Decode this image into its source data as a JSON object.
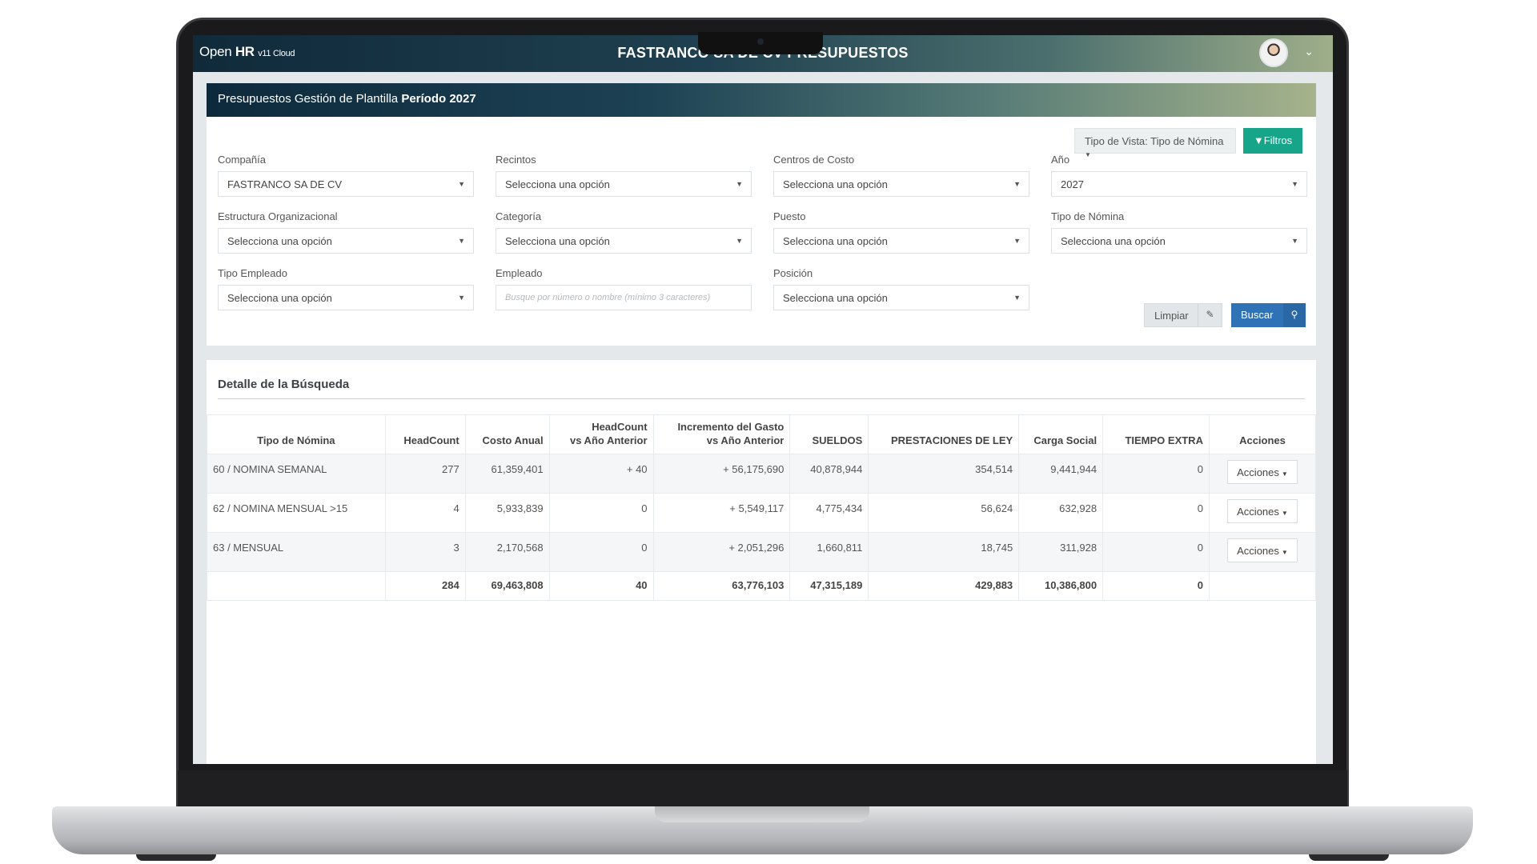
{
  "app": {
    "brand_open": "Open",
    "brand_hr": "HR",
    "brand_version": "v11 Cloud",
    "title": "FASTRANCO SA DE CV PRESUPUESTOS"
  },
  "hero": {
    "title": "Presupuestos Gestión de Plantilla",
    "period": "Período 2027"
  },
  "toolbar": {
    "view_type": "Tipo de Vista: Tipo de Nómina",
    "filters_label": "Filtros"
  },
  "filters": {
    "company": {
      "label": "Compañía",
      "value": "FASTRANCO SA DE CV"
    },
    "venues": {
      "label": "Recintos",
      "value": "Selecciona una opción"
    },
    "cost_centers": {
      "label": "Centros de Costo",
      "value": "Selecciona una opción"
    },
    "year": {
      "label": "Año",
      "value": "2027"
    },
    "org_structure": {
      "label": "Estructura Organizacional",
      "value": "Selecciona una opción"
    },
    "category": {
      "label": "Categoría",
      "value": "Selecciona una opción"
    },
    "position_job": {
      "label": "Puesto",
      "value": "Selecciona una opción"
    },
    "payroll_type": {
      "label": "Tipo de Nómina",
      "value": "Selecciona una opción"
    },
    "employee_type": {
      "label": "Tipo Empleado",
      "value": "Selecciona una opción"
    },
    "employee": {
      "label": "Empleado",
      "placeholder": "Busque por número o nombre (mínimo 3 caracteres)"
    },
    "position": {
      "label": "Posición",
      "value": "Selecciona una opción"
    }
  },
  "actions": {
    "clear_label": "Limpiar",
    "search_label": "Buscar"
  },
  "results": {
    "title": "Detalle de la Búsqueda",
    "columns": {
      "payroll_type": "Tipo de Nómina",
      "headcount": "HeadCount",
      "annual_cost": "Costo Anual",
      "headcount_vs_line1": "HeadCount",
      "headcount_vs_line2": "vs Año Anterior",
      "expense_inc_line1": "Incremento del Gasto",
      "expense_inc_line2": "vs Año Anterior",
      "salaries": "SUELDOS",
      "benefits": "PRESTACIONES DE LEY",
      "social_charge": "Carga Social",
      "overtime": "TIEMPO EXTRA",
      "actions": "Acciones"
    },
    "rows": [
      {
        "payroll_type": "60 / NOMINA SEMANAL",
        "headcount": "277",
        "annual_cost": "61,359,401",
        "headcount_vs": "+ 40",
        "expense_inc": "+ 56,175,690",
        "salaries": "40,878,944",
        "benefits": "354,514",
        "social_charge": "9,441,944",
        "overtime": "0",
        "action": "Acciones"
      },
      {
        "payroll_type": "62 / NOMINA MENSUAL >15",
        "headcount": "4",
        "annual_cost": "5,933,839",
        "headcount_vs": "0",
        "expense_inc": "+ 5,549,117",
        "salaries": "4,775,434",
        "benefits": "56,624",
        "social_charge": "632,928",
        "overtime": "0",
        "action": "Acciones"
      },
      {
        "payroll_type": "63 / MENSUAL",
        "headcount": "3",
        "annual_cost": "2,170,568",
        "headcount_vs": "0",
        "expense_inc": "+ 2,051,296",
        "salaries": "1,660,811",
        "benefits": "18,745",
        "social_charge": "311,928",
        "overtime": "0",
        "action": "Acciones"
      }
    ],
    "totals": {
      "headcount": "284",
      "annual_cost": "69,463,808",
      "headcount_vs": "40",
      "expense_inc": "63,776,103",
      "salaries": "47,315,189",
      "benefits": "429,883",
      "social_charge": "10,386,800",
      "overtime": "0"
    }
  },
  "colors": {
    "header_dark": "#102a3a",
    "header_light": "#9fae8a",
    "filter_button": "#17a589",
    "search_button": "#2f72b6"
  }
}
